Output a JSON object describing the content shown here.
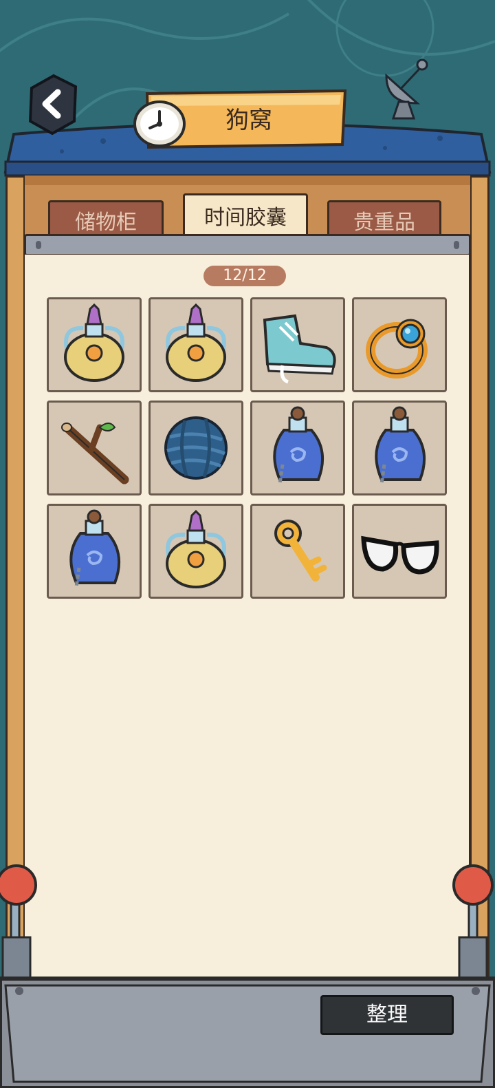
{
  "header": {
    "title": "狗窝"
  },
  "tabs": [
    {
      "label": "储物柜",
      "active": false
    },
    {
      "label": "时间胶囊",
      "active": true
    },
    {
      "label": "贵重品",
      "active": false
    }
  ],
  "capacity": "12/12",
  "items": [
    {
      "icon": "golden-potion-icon"
    },
    {
      "icon": "golden-potion-icon"
    },
    {
      "icon": "sneaker-icon"
    },
    {
      "icon": "gold-ring-icon"
    },
    {
      "icon": "branch-icon"
    },
    {
      "icon": "yarn-ball-icon"
    },
    {
      "icon": "blue-potion-icon"
    },
    {
      "icon": "blue-potion-icon"
    },
    {
      "icon": "blue-potion-icon"
    },
    {
      "icon": "golden-potion-icon"
    },
    {
      "icon": "gold-key-icon"
    },
    {
      "icon": "glasses-icon"
    }
  ],
  "footer": {
    "sort_label": "整理"
  },
  "colors": {
    "background": "#2f6b74",
    "roof": "#2f5f9e",
    "wood": "#d9a35f",
    "panel": "#f7efdb"
  }
}
